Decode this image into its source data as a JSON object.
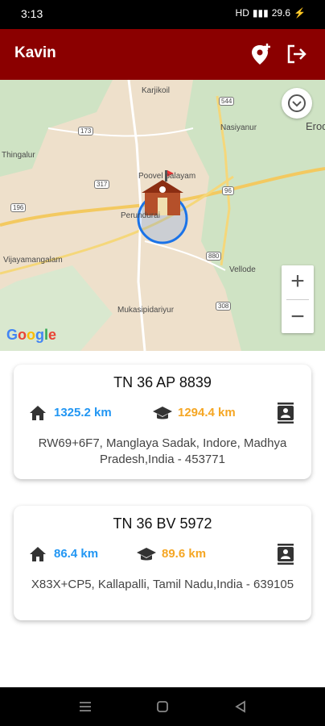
{
  "status_bar": {
    "time": "3:13",
    "network_speed": "29.6"
  },
  "app_bar": {
    "title": "Kavin",
    "add_location_icon": "add-location-icon",
    "logout_icon": "logout-icon"
  },
  "map": {
    "labels": {
      "karikkoil": "Karjikoil",
      "nasiyanur": "Nasiyanur",
      "erode": "Erod",
      "thingalur": "Thingalur",
      "poovel": "Poovel palayam",
      "perundurai": "Perundurai",
      "vijayamangalam": "Vijayamangalam",
      "vellode": "Vellode",
      "mukasi": "Mukasipidariyur",
      "google": "Google"
    },
    "shields": {
      "r544": "544",
      "r173": "173",
      "r317": "317",
      "r96": "96",
      "r196": "196",
      "r880": "880",
      "r308": "308"
    },
    "zoom_in": "+",
    "zoom_out": "−"
  },
  "vehicles": [
    {
      "plate": "TN 36 AP 8839",
      "home_distance": "1325.2 km",
      "school_distance": "1294.4 km",
      "address": "RW69+6F7, Manglaya Sadak, Indore, Madhya Pradesh,India - 453771"
    },
    {
      "plate": "TN 36 BV 5972",
      "home_distance": "86.4 km",
      "school_distance": "89.6 km",
      "address": "X83X+CP5, Kallapalli, Tamil Nadu,India - 639105"
    }
  ],
  "colors": {
    "appbar": "#8b0000",
    "home_distance": "#2196f3",
    "school_distance": "#f5a623"
  }
}
